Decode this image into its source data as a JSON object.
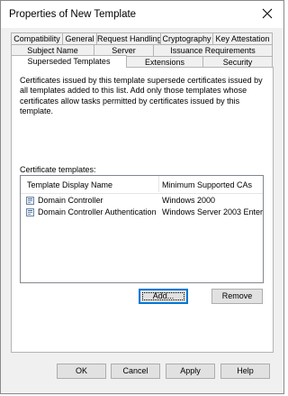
{
  "window": {
    "title": "Properties of New Template",
    "close_icon": "close-icon"
  },
  "tabs": {
    "row1": [
      "Compatibility",
      "General",
      "Request Handling",
      "Cryptography",
      "Key Attestation"
    ],
    "row2": [
      "Subject Name",
      "Server",
      "Issuance Requirements"
    ],
    "row3": [
      "Superseded Templates",
      "Extensions",
      "Security"
    ],
    "active": "Superseded Templates"
  },
  "page": {
    "description": "Certificates issued by this template supersede certificates issued by all templates added to this list. Add only those templates whose certificates allow tasks permitted by certificates issued by this template.",
    "list_label": "Certificate templates:",
    "columns": [
      "Template Display Name",
      "Minimum Supported CAs"
    ],
    "rows": [
      {
        "name": "Domain Controller",
        "ca": "Windows 2000",
        "icon": "template-icon"
      },
      {
        "name": "Domain Controller Authentication",
        "ca": "Windows Server 2003 Enter...",
        "icon": "template-icon"
      }
    ],
    "add_label": "Add...",
    "remove_label": "Remove"
  },
  "footer": {
    "ok_label": "OK",
    "cancel_label": "Cancel",
    "apply_label": "Apply",
    "help_label": "Help"
  }
}
